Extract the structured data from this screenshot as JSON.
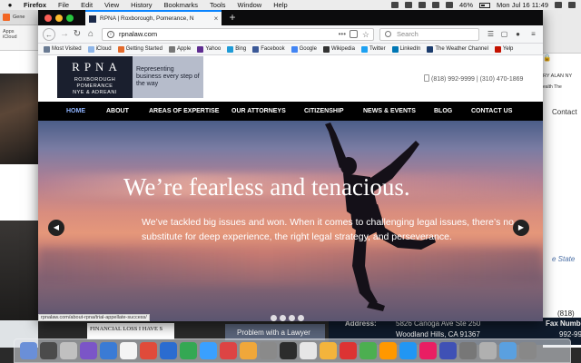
{
  "menubar": {
    "app_name": "Firefox",
    "menus": [
      "File",
      "Edit",
      "View",
      "History",
      "Bookmarks",
      "Tools",
      "Window",
      "Help"
    ],
    "battery": "46%",
    "clock": "Mon Jul 16  11:49"
  },
  "bg_left": {
    "tab_label": "Gene",
    "toolbar_items": [
      "Apps",
      "iCloud"
    ]
  },
  "bg_right": {
    "line1": "RY ALAN NY",
    "line2": "ealth   The",
    "contact": "Contact",
    "state": "e State",
    "phone_a1": "(818)",
    "phone_a2": "992-99",
    "phone_b1": "(818)",
    "phone_b2": "992-99"
  },
  "peek": {
    "financial": "FINANCIAL LOSS I HAVE S",
    "problem": "Problem with a Lawyer",
    "address_label": "Address:",
    "address_line1": "5826 Canoga Ave Ste 250",
    "address_line2": "Woodland Hills, CA 91367",
    "fax_label": "Fax Number:"
  },
  "browser": {
    "tab_title": "RPNA | Roxborough, Pomerance, N",
    "url": "rpnalaw.com",
    "search_placeholder": "Search",
    "bookmarks": [
      {
        "label": "Most Visited",
        "color": "#6a7b93"
      },
      {
        "label": "iCloud",
        "color": "#8fb6e8"
      },
      {
        "label": "Getting Started",
        "color": "#e36a2b"
      },
      {
        "label": "Apple",
        "color": "#777777"
      },
      {
        "label": "Yahoo",
        "color": "#5f2d91"
      },
      {
        "label": "Bing",
        "color": "#1f9bd7"
      },
      {
        "label": "Facebook",
        "color": "#3b5998"
      },
      {
        "label": "Google",
        "color": "#4285f4"
      },
      {
        "label": "Wikipedia",
        "color": "#333333"
      },
      {
        "label": "Twitter",
        "color": "#1da1f2"
      },
      {
        "label": "LinkedIn",
        "color": "#0077b5"
      },
      {
        "label": "The Weather Channel",
        "color": "#1b3c6d"
      },
      {
        "label": "Yelp",
        "color": "#c41200"
      }
    ],
    "status_url": "rpnalaw.com/about-rpna/trial-appellate-success/"
  },
  "site": {
    "logo_main": "RPNA",
    "logo_sub1": "ROXBOROUGH",
    "logo_sub2": "POMERANCE",
    "logo_sub3": "NYE & ADREANI",
    "tagline": "Representing business every step of the way",
    "phones": "(818) 992-9999 | (310) 470-1869",
    "nav": [
      "HOME",
      "ABOUT",
      "AREAS OF EXPERTISE",
      "OUR ATTORNEYS",
      "CITIZENSHIP",
      "NEWS & EVENTS",
      "BLOG",
      "CONTACT US"
    ],
    "hero_title": "We’re fearless and tenacious.",
    "hero_body": "We’ve tackled big issues and won. When it comes to challenging legal issues, there’s no substitute for deep experience, the right legal strategy, and perseverance."
  },
  "dock_colors": [
    "#6a8fd8",
    "#4b4b4b",
    "#c0c0c0",
    "#7b55c7",
    "#3a7bd5",
    "#f4f4f4",
    "#e04b3a",
    "#2b6cd0",
    "#34a853",
    "#3aa0ff",
    "#d44",
    "#f0a73a",
    "#8a8a8a",
    "#2c2c2c",
    "#e6e6e6",
    "#f3b43c",
    "#d33",
    "#4caf50",
    "#ff9800",
    "#2196f3",
    "#e91e63",
    "#3f51b5",
    "#777777",
    "#b0b0b0",
    "#5aa0e0",
    "#888888"
  ]
}
